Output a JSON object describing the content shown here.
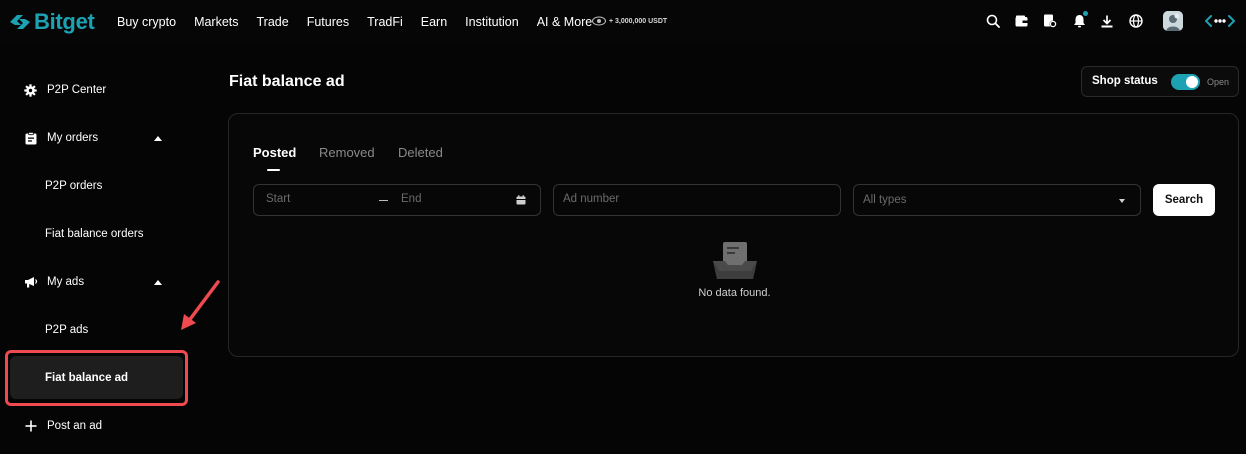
{
  "brand": {
    "name": "Bitget",
    "accent": "#1da2b4"
  },
  "nav": {
    "items": [
      "Buy crypto",
      "Markets",
      "Trade",
      "Futures",
      "TradFi",
      "Earn",
      "Institution",
      "AI & More"
    ],
    "promo": "+ 3,000,000 USDT"
  },
  "top_icons": [
    "search-icon",
    "wallet-icon",
    "orders-icon",
    "bell-icon",
    "download-icon",
    "globe-icon",
    "avatar",
    "assistant-icon"
  ],
  "sidebar": {
    "p2p_center": "P2P Center",
    "my_orders": "My orders",
    "p2p_orders": "P2P orders",
    "fiat_balance_orders": "Fiat balance orders",
    "my_ads": "My ads",
    "p2p_ads": "P2P ads",
    "fiat_balance_ad": "Fiat balance ad",
    "post_an_ad": "Post an ad",
    "active_item": "Fiat balance ad",
    "highlight_color": "#ef4a50"
  },
  "main": {
    "title": "Fiat balance ad",
    "shop_status": {
      "label": "Shop status",
      "state": "Open",
      "enabled": true
    },
    "tabs": [
      {
        "label": "Posted",
        "active": true
      },
      {
        "label": "Removed",
        "active": false
      },
      {
        "label": "Deleted",
        "active": false
      }
    ],
    "filters": {
      "start_placeholder": "Start",
      "end_placeholder": "End",
      "ad_number_placeholder": "Ad number",
      "type_select": "All types",
      "search_button": "Search"
    },
    "empty_text": "No data found."
  }
}
